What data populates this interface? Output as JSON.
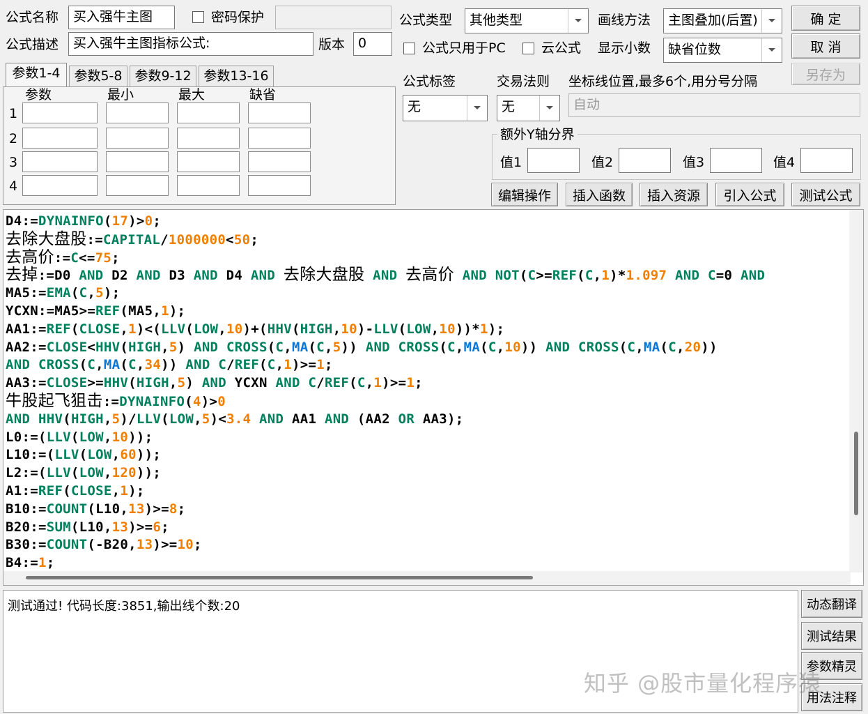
{
  "header": {
    "formula_name_label": "公式名称",
    "formula_name_value": "买入强牛主图",
    "password_label": "密码保护",
    "password_value": "",
    "formula_type_label": "公式类型",
    "formula_type_value": "其他类型",
    "draw_method_label": "画线方法",
    "draw_method_value": "主图叠加(后置)",
    "desc_label": "公式描述",
    "desc_value": "买入强牛主图指标公式:",
    "version_label": "版本",
    "version_value": "0",
    "pc_only_label": "公式只用于PC",
    "cloud_label": "云公式",
    "decimals_label": "显示小数",
    "decimals_value": "缺省位数"
  },
  "buttons": {
    "ok": "确  定",
    "cancel": "取  消",
    "save_as": "另存为"
  },
  "tabs": [
    "参数1-4",
    "参数5-8",
    "参数9-12",
    "参数13-16"
  ],
  "params": {
    "headers": [
      "参数",
      "最小",
      "最大",
      "缺省"
    ],
    "rows": [
      "1",
      "2",
      "3",
      "4"
    ]
  },
  "options": {
    "tag_label": "公式标签",
    "tag_value": "无",
    "rule_label": "交易法则",
    "rule_value": "无",
    "axis_label": "坐标线位置,最多6个,用分号分隔",
    "axis_value": "自动",
    "yaxis_group_label": "额外Y轴分界",
    "y_labels": [
      "值1",
      "值2",
      "值3",
      "值4"
    ]
  },
  "tools": [
    "编辑操作",
    "插入函数",
    "插入资源",
    "引入公式",
    "测试公式"
  ],
  "output_text": "测试通过! 代码长度:3851,输出线个数:20",
  "side_buttons": [
    "动态翻译",
    "测试结果",
    "参数精灵",
    "用法注释"
  ],
  "watermark": "知乎 @股市量化程序猿",
  "code_lines": [
    [
      [
        "k",
        "D4:="
      ],
      [
        "f",
        "DYNAINFO"
      ],
      [
        "k",
        "("
      ],
      [
        "n",
        "17"
      ],
      [
        "k",
        ")>"
      ],
      [
        "n",
        "0"
      ],
      [
        "k",
        ";"
      ]
    ],
    [
      [
        "cn",
        "去除大盘股"
      ],
      [
        "k",
        ":="
      ],
      [
        "f",
        "CAPITAL"
      ],
      [
        "k",
        "/"
      ],
      [
        "n",
        "1000000"
      ],
      [
        "k",
        "<"
      ],
      [
        "n",
        "50"
      ],
      [
        "k",
        ";"
      ]
    ],
    [
      [
        "cn",
        "去高价"
      ],
      [
        "k",
        ":="
      ],
      [
        "f",
        "C"
      ],
      [
        "k",
        "<="
      ],
      [
        "n",
        "75"
      ],
      [
        "k",
        ";"
      ]
    ],
    [
      [
        "cn",
        "去掉"
      ],
      [
        "k",
        ":=D0 "
      ],
      [
        "f",
        "AND"
      ],
      [
        "k",
        " D2 "
      ],
      [
        "f",
        "AND"
      ],
      [
        "k",
        " D3 "
      ],
      [
        "f",
        "AND"
      ],
      [
        "k",
        " D4 "
      ],
      [
        "f",
        "AND"
      ],
      [
        "k",
        " "
      ],
      [
        "cn",
        "去除大盘股"
      ],
      [
        "k",
        " "
      ],
      [
        "f",
        "AND"
      ],
      [
        "k",
        " "
      ],
      [
        "cn",
        "去高价"
      ],
      [
        "k",
        " "
      ],
      [
        "f",
        "AND"
      ],
      [
        "k",
        " "
      ],
      [
        "f",
        "NOT"
      ],
      [
        "k",
        "("
      ],
      [
        "f",
        "C"
      ],
      [
        "k",
        ">="
      ],
      [
        "f",
        "REF"
      ],
      [
        "k",
        "("
      ],
      [
        "f",
        "C"
      ],
      [
        "k",
        ","
      ],
      [
        "n",
        "1"
      ],
      [
        "k",
        ")*"
      ],
      [
        "n",
        "1.097"
      ],
      [
        "k",
        " "
      ],
      [
        "f",
        "AND"
      ],
      [
        "k",
        " "
      ],
      [
        "f",
        "C"
      ],
      [
        "k",
        "=0 "
      ],
      [
        "f",
        "AND"
      ]
    ],
    [
      [
        "k",
        "MA5:="
      ],
      [
        "f",
        "EMA"
      ],
      [
        "k",
        "("
      ],
      [
        "f",
        "C"
      ],
      [
        "k",
        ","
      ],
      [
        "n",
        "5"
      ],
      [
        "k",
        ");"
      ]
    ],
    [
      [
        "k",
        "YCXN:=MA5>="
      ],
      [
        "f",
        "REF"
      ],
      [
        "k",
        "(MA5,"
      ],
      [
        "n",
        "1"
      ],
      [
        "k",
        ");"
      ]
    ],
    [
      [
        "k",
        "AA1:="
      ],
      [
        "f",
        "REF"
      ],
      [
        "k",
        "("
      ],
      [
        "f",
        "CLOSE"
      ],
      [
        "k",
        ","
      ],
      [
        "n",
        "1"
      ],
      [
        "k",
        ")<("
      ],
      [
        "f",
        "LLV"
      ],
      [
        "k",
        "("
      ],
      [
        "f",
        "LOW"
      ],
      [
        "k",
        ","
      ],
      [
        "n",
        "10"
      ],
      [
        "k",
        ")+("
      ],
      [
        "f",
        "HHV"
      ],
      [
        "k",
        "("
      ],
      [
        "f",
        "HIGH"
      ],
      [
        "k",
        ","
      ],
      [
        "n",
        "10"
      ],
      [
        "k",
        ")-"
      ],
      [
        "f",
        "LLV"
      ],
      [
        "k",
        "("
      ],
      [
        "f",
        "LOW"
      ],
      [
        "k",
        ","
      ],
      [
        "n",
        "10"
      ],
      [
        "k",
        "))*"
      ],
      [
        "n",
        "1"
      ],
      [
        "k",
        ");"
      ]
    ],
    [
      [
        "k",
        "AA2:="
      ],
      [
        "f",
        "CLOSE"
      ],
      [
        "k",
        "<"
      ],
      [
        "f",
        "HHV"
      ],
      [
        "k",
        "("
      ],
      [
        "f",
        "HIGH"
      ],
      [
        "k",
        ","
      ],
      [
        "n",
        "5"
      ],
      [
        "k",
        ") "
      ],
      [
        "f",
        "AND"
      ],
      [
        "k",
        " "
      ],
      [
        "f",
        "CROSS"
      ],
      [
        "k",
        "("
      ],
      [
        "f",
        "C"
      ],
      [
        "k",
        ","
      ],
      [
        "v",
        "MA"
      ],
      [
        "k",
        "("
      ],
      [
        "f",
        "C"
      ],
      [
        "k",
        ","
      ],
      [
        "n",
        "5"
      ],
      [
        "k",
        ")) "
      ],
      [
        "f",
        "AND"
      ],
      [
        "k",
        " "
      ],
      [
        "f",
        "CROSS"
      ],
      [
        "k",
        "("
      ],
      [
        "f",
        "C"
      ],
      [
        "k",
        ","
      ],
      [
        "v",
        "MA"
      ],
      [
        "k",
        "("
      ],
      [
        "f",
        "C"
      ],
      [
        "k",
        ","
      ],
      [
        "n",
        "10"
      ],
      [
        "k",
        ")) "
      ],
      [
        "f",
        "AND"
      ],
      [
        "k",
        " "
      ],
      [
        "f",
        "CROSS"
      ],
      [
        "k",
        "("
      ],
      [
        "f",
        "C"
      ],
      [
        "k",
        ","
      ],
      [
        "v",
        "MA"
      ],
      [
        "k",
        "("
      ],
      [
        "f",
        "C"
      ],
      [
        "k",
        ","
      ],
      [
        "n",
        "20"
      ],
      [
        "k",
        "))"
      ]
    ],
    [
      [
        "f",
        "AND"
      ],
      [
        "k",
        " "
      ],
      [
        "f",
        "CROSS"
      ],
      [
        "k",
        "("
      ],
      [
        "f",
        "C"
      ],
      [
        "k",
        ","
      ],
      [
        "v",
        "MA"
      ],
      [
        "k",
        "("
      ],
      [
        "f",
        "C"
      ],
      [
        "k",
        ","
      ],
      [
        "n",
        "34"
      ],
      [
        "k",
        ")) "
      ],
      [
        "f",
        "AND"
      ],
      [
        "k",
        " "
      ],
      [
        "f",
        "C"
      ],
      [
        "k",
        "/"
      ],
      [
        "f",
        "REF"
      ],
      [
        "k",
        "("
      ],
      [
        "f",
        "C"
      ],
      [
        "k",
        ","
      ],
      [
        "n",
        "1"
      ],
      [
        "k",
        ")>="
      ],
      [
        "n",
        "1"
      ],
      [
        "k",
        ";"
      ]
    ],
    [
      [
        "k",
        "AA3:="
      ],
      [
        "f",
        "CLOSE"
      ],
      [
        "k",
        ">="
      ],
      [
        "f",
        "HHV"
      ],
      [
        "k",
        "("
      ],
      [
        "f",
        "HIGH"
      ],
      [
        "k",
        ","
      ],
      [
        "n",
        "5"
      ],
      [
        "k",
        ") "
      ],
      [
        "f",
        "AND"
      ],
      [
        "k",
        " YCXN "
      ],
      [
        "f",
        "AND"
      ],
      [
        "k",
        " "
      ],
      [
        "f",
        "C"
      ],
      [
        "k",
        "/"
      ],
      [
        "f",
        "REF"
      ],
      [
        "k",
        "("
      ],
      [
        "f",
        "C"
      ],
      [
        "k",
        ","
      ],
      [
        "n",
        "1"
      ],
      [
        "k",
        ")>="
      ],
      [
        "n",
        "1"
      ],
      [
        "k",
        ";"
      ]
    ],
    [
      [
        "cn",
        "牛股起飞狙击"
      ],
      [
        "k",
        ":="
      ],
      [
        "f",
        "DYNAINFO"
      ],
      [
        "k",
        "("
      ],
      [
        "n",
        "4"
      ],
      [
        "k",
        ")>"
      ],
      [
        "n",
        "0"
      ]
    ],
    [
      [
        "f",
        "AND"
      ],
      [
        "k",
        " "
      ],
      [
        "f",
        "HHV"
      ],
      [
        "k",
        "("
      ],
      [
        "f",
        "HIGH"
      ],
      [
        "k",
        ","
      ],
      [
        "n",
        "5"
      ],
      [
        "k",
        ")/"
      ],
      [
        "f",
        "LLV"
      ],
      [
        "k",
        "("
      ],
      [
        "f",
        "LOW"
      ],
      [
        "k",
        ","
      ],
      [
        "n",
        "5"
      ],
      [
        "k",
        ")<"
      ],
      [
        "n",
        "3.4"
      ],
      [
        "k",
        " "
      ],
      [
        "f",
        "AND"
      ],
      [
        "k",
        " AA1 "
      ],
      [
        "f",
        "AND"
      ],
      [
        "k",
        " (AA2 "
      ],
      [
        "f",
        "OR"
      ],
      [
        "k",
        " AA3);"
      ]
    ],
    [
      [
        "k",
        "L0:=("
      ],
      [
        "f",
        "LLV"
      ],
      [
        "k",
        "("
      ],
      [
        "f",
        "LOW"
      ],
      [
        "k",
        ","
      ],
      [
        "n",
        "10"
      ],
      [
        "k",
        "));"
      ]
    ],
    [
      [
        "k",
        "L10:=("
      ],
      [
        "f",
        "LLV"
      ],
      [
        "k",
        "("
      ],
      [
        "f",
        "LOW"
      ],
      [
        "k",
        ","
      ],
      [
        "n",
        "60"
      ],
      [
        "k",
        "));"
      ]
    ],
    [
      [
        "k",
        "L2:=("
      ],
      [
        "f",
        "LLV"
      ],
      [
        "k",
        "("
      ],
      [
        "f",
        "LOW"
      ],
      [
        "k",
        ","
      ],
      [
        "n",
        "120"
      ],
      [
        "k",
        "));"
      ]
    ],
    [
      [
        "k",
        "A1:="
      ],
      [
        "f",
        "REF"
      ],
      [
        "k",
        "("
      ],
      [
        "f",
        "CLOSE"
      ],
      [
        "k",
        ","
      ],
      [
        "n",
        "1"
      ],
      [
        "k",
        ");"
      ]
    ],
    [
      [
        "k",
        "B10:="
      ],
      [
        "f",
        "COUNT"
      ],
      [
        "k",
        "(L10,"
      ],
      [
        "n",
        "13"
      ],
      [
        "k",
        ")>="
      ],
      [
        "n",
        "8"
      ],
      [
        "k",
        ";"
      ]
    ],
    [
      [
        "k",
        "B20:="
      ],
      [
        "f",
        "SUM"
      ],
      [
        "k",
        "(L10,"
      ],
      [
        "n",
        "13"
      ],
      [
        "k",
        ")>="
      ],
      [
        "n",
        "6"
      ],
      [
        "k",
        ";"
      ]
    ],
    [
      [
        "k",
        "B30:="
      ],
      [
        "f",
        "COUNT"
      ],
      [
        "k",
        "(-B20,"
      ],
      [
        "n",
        "13"
      ],
      [
        "k",
        ")>="
      ],
      [
        "n",
        "10"
      ],
      [
        "k",
        ";"
      ]
    ],
    [
      [
        "k",
        "B4:="
      ],
      [
        "n",
        "1"
      ],
      [
        "k",
        ";"
      ]
    ]
  ]
}
